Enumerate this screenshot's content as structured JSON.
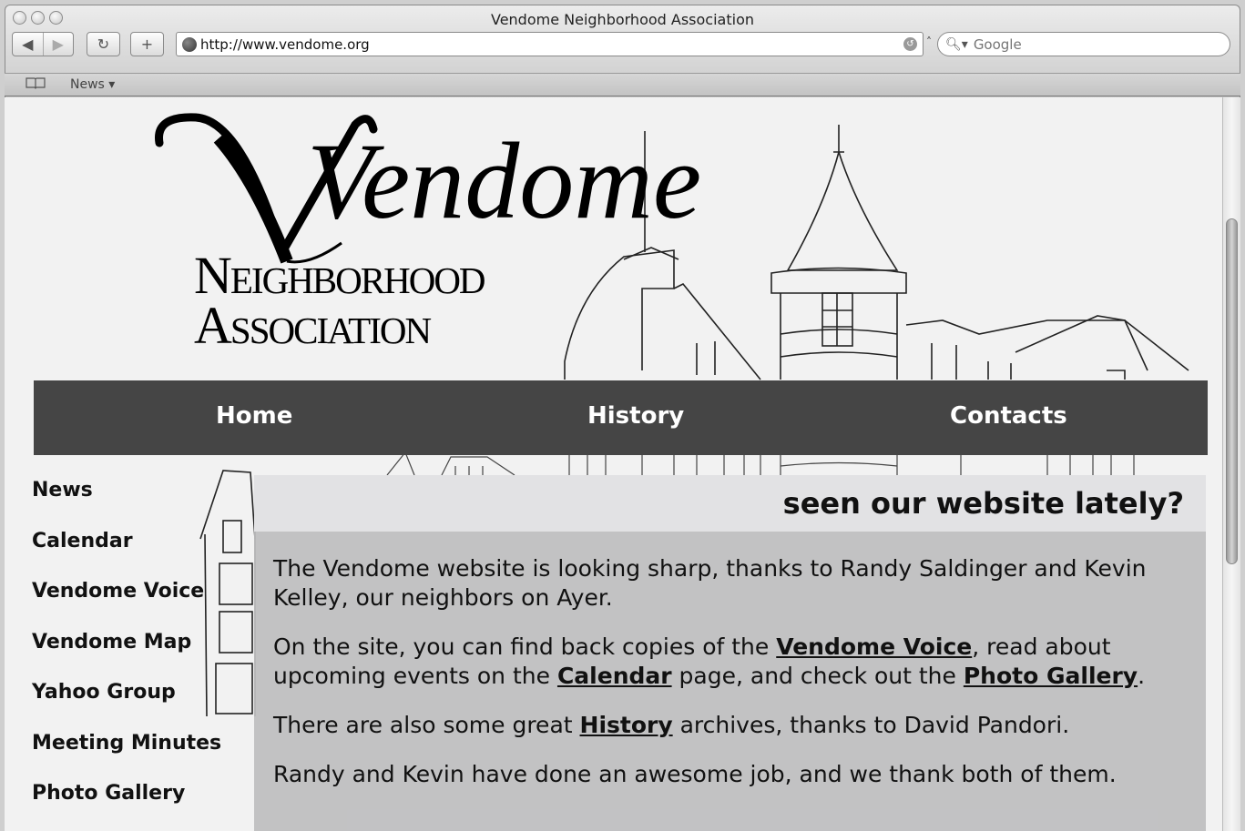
{
  "window": {
    "title": "Vendome Neighborhood Association"
  },
  "toolbar": {
    "url": "http://www.vendome.org",
    "search_placeholder": "Google"
  },
  "bookmarks": {
    "items": [
      "News ▾"
    ]
  },
  "logo": {
    "script_word": "Vendome",
    "line1": "Neighborhood",
    "line2": "Association"
  },
  "nav": {
    "items": [
      "Home",
      "History",
      "Contacts"
    ]
  },
  "sidebar": {
    "items": [
      "News",
      "Calendar",
      "Vendome Voice",
      "Vendome Map",
      "Yahoo Group",
      "Meeting Minutes",
      "Photo Gallery"
    ]
  },
  "article": {
    "heading": "seen our website lately?",
    "p1": "The Vendome website is looking sharp, thanks to Randy Saldinger and Kevin Kelley, our neighbors on Ayer.",
    "p2_a": "On the site, you can find back copies of the ",
    "p2_link1": "Vendome Voice",
    "p2_b": ", read about upcoming events on the ",
    "p2_link2": "Calendar",
    "p2_c": " page, and check out the ",
    "p2_link3": "Photo Gallery",
    "p2_d": ".",
    "p3_a": "There are also some great ",
    "p3_link": "History",
    "p3_b": " archives, thanks to David Pandori.",
    "p4": "Randy and Kevin have done an awesome job, and we thank both of them."
  },
  "colors": {
    "navbar_bg": "#454545",
    "page_bg": "#f2f2f2",
    "content_bg": "#bebec0",
    "content_head_bg": "#e2e2e4"
  }
}
